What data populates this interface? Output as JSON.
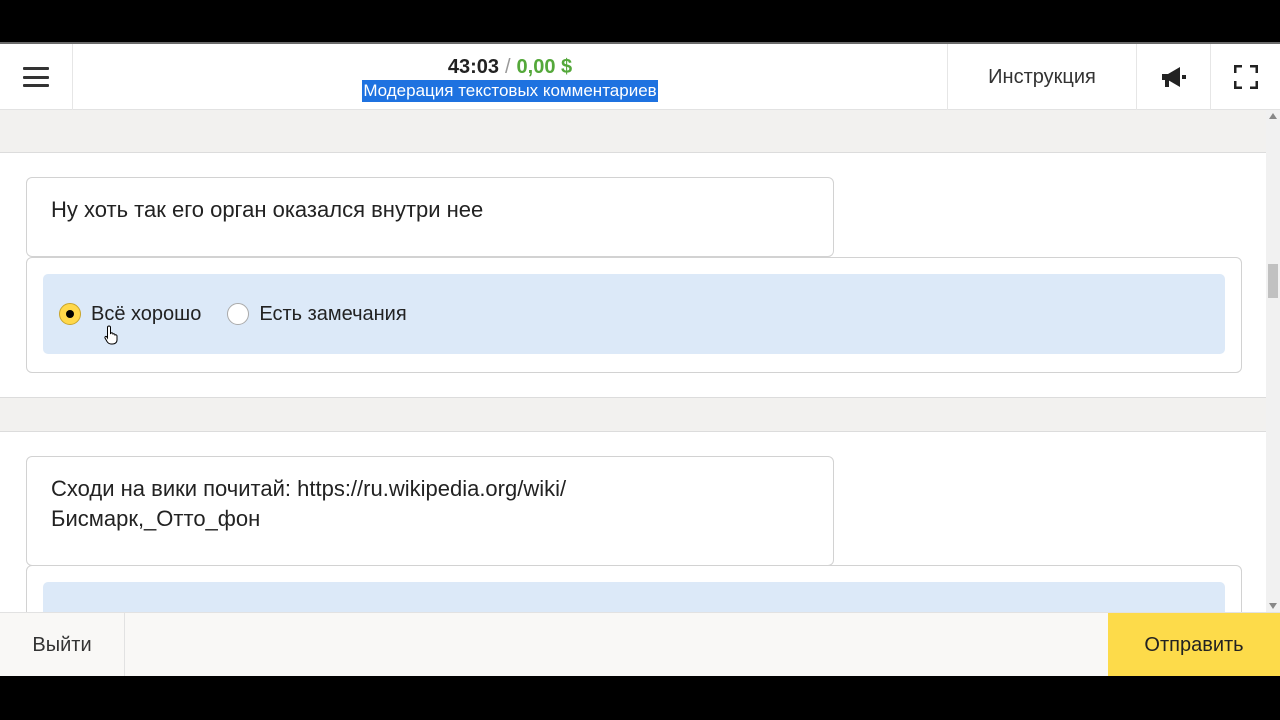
{
  "header": {
    "timer": "43:03",
    "separator": "/",
    "earnings": "0,00 $",
    "task_title": "Модерация текстовых комментариев",
    "instruction_label": "Инструкция"
  },
  "tasks": [
    {
      "comment": "Ну хоть так его орган оказался внутри нее",
      "options": [
        {
          "label": "Всё хорошо",
          "checked": true
        },
        {
          "label": "Есть замечания",
          "checked": false
        }
      ]
    },
    {
      "comment_line1": "Сходи на вики почитай: https://ru.wikipedia.org/wiki/",
      "comment_line2": "Бисмарк,_Отто_фон"
    }
  ],
  "footer": {
    "exit_label": "Выйти",
    "submit_label": "Отправить"
  },
  "icons": {
    "menu": "hamburger-menu-icon",
    "megaphone": "megaphone-icon",
    "fullscreen": "fullscreen-icon"
  },
  "colors": {
    "earnings": "#54a83a",
    "title_highlight": "#1e72e0",
    "answer_bg": "#dce9f8",
    "radio_checked": "#ffd84a",
    "submit_bg": "#fddb4a"
  }
}
